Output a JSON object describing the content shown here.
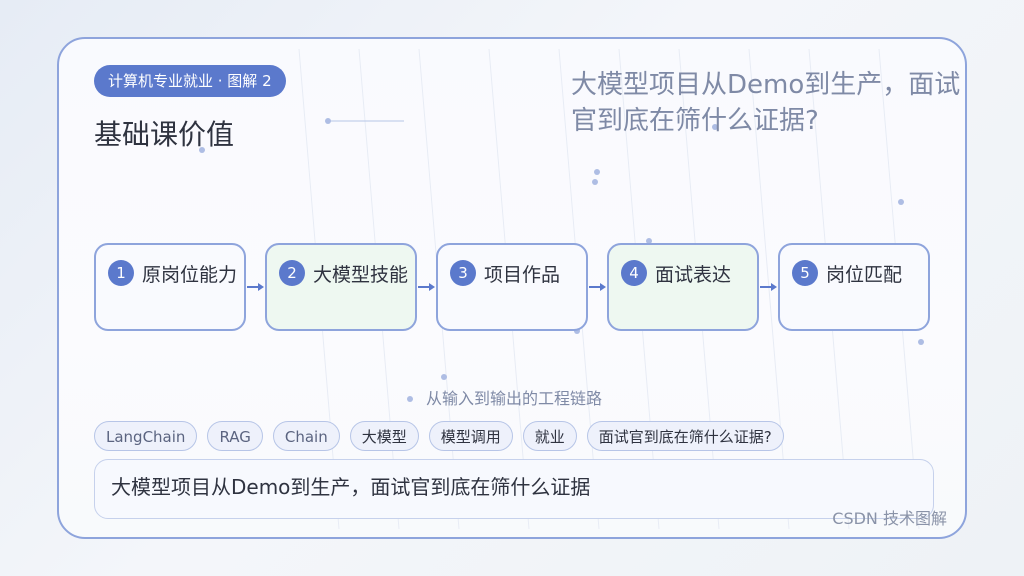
{
  "badge": {
    "text": "计算机专业就业 · 图解 2"
  },
  "subtitle": "基础课价值",
  "headline": "大模型项目从Demo到生产，面试官到底在筛什么证据?",
  "steps": [
    {
      "num": "1",
      "label": "原岗位能力"
    },
    {
      "num": "2",
      "label": "大模型技能"
    },
    {
      "num": "3",
      "label": "项目作品"
    },
    {
      "num": "4",
      "label": "面试表达"
    },
    {
      "num": "5",
      "label": "岗位匹配"
    }
  ],
  "caption": "从输入到输出的工程链路",
  "tags": [
    "LangChain",
    "RAG",
    "Chain",
    "大模型",
    "模型调用",
    "就业",
    "面试官到底在筛什么证据?"
  ],
  "summary": "大模型项目从Demo到生产，面试官到底在筛什么证据",
  "footer": "CSDN 技术图解",
  "colors": {
    "accent": "#5b79cc",
    "border": "#8ea4dc",
    "green_fill": "#eef8f1",
    "text": "#2f3340",
    "muted": "#7f8aa6"
  }
}
